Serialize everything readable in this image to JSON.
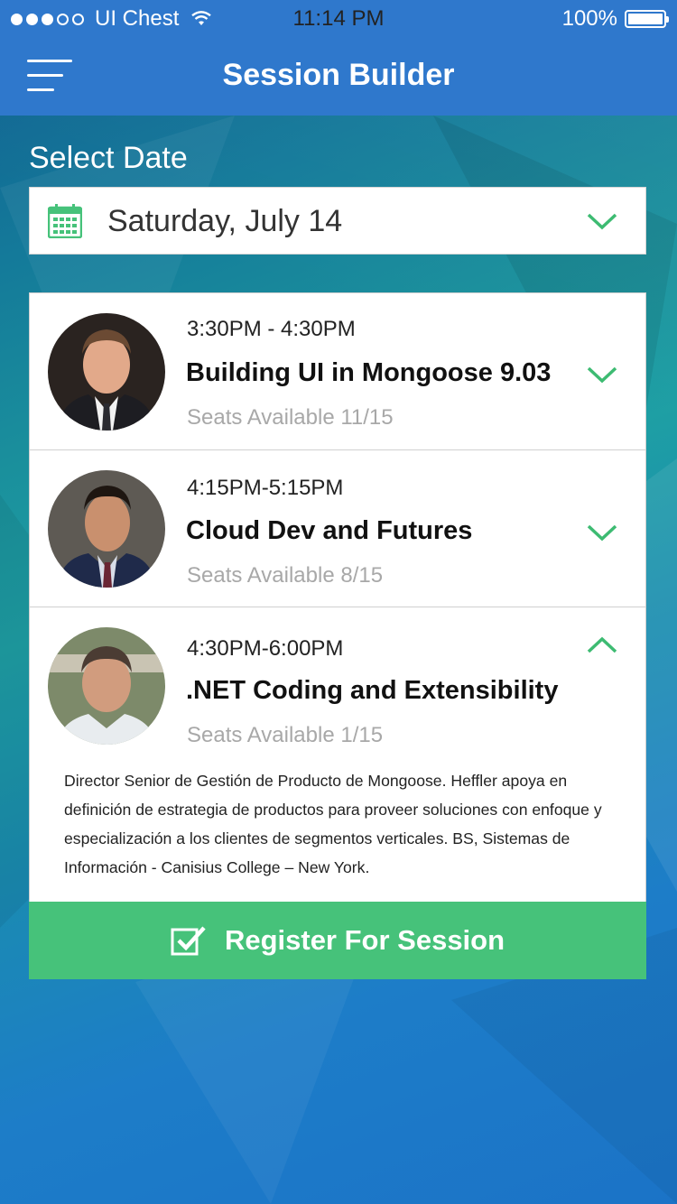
{
  "status_bar": {
    "carrier": "UI Chest",
    "time": "11:14 PM",
    "battery_text": "100%",
    "battery_level": 1.0,
    "signal_bars": 3,
    "signal_total": 5
  },
  "nav": {
    "title": "Session Builder",
    "menu_icon": "hamburger-menu-icon"
  },
  "date_picker": {
    "label": "Select Date",
    "value": "Saturday, July 14",
    "icon": "calendar-icon"
  },
  "sessions": [
    {
      "time": "3:30PM - 4:30PM",
      "title": "Building UI in Mongoose 9.03",
      "seats": "Seats Available 11/15",
      "expanded": false
    },
    {
      "time": "4:15PM-5:15PM",
      "title": "Cloud Dev and Futures",
      "seats": "Seats Available 8/15",
      "expanded": false
    },
    {
      "time": "4:30PM-6:00PM",
      "title": ".NET Coding and Extensibility",
      "seats": "Seats Available 1/15",
      "expanded": true,
      "description": "Director Senior de Gestión de Producto de Mongoose. Heffler apoya en definición de estrategia de productos para proveer soluciones con enfoque y especialización a los clientes de segmentos verticales. BS, Sistemas de Información - Canisius College – New York."
    }
  ],
  "register_button": {
    "label": "Register For Session",
    "icon": "checkbox-check-icon"
  },
  "colors": {
    "nav_blue": "#2f78cc",
    "accent_green": "#46c27a",
    "chevron_green": "#3dbb72"
  }
}
